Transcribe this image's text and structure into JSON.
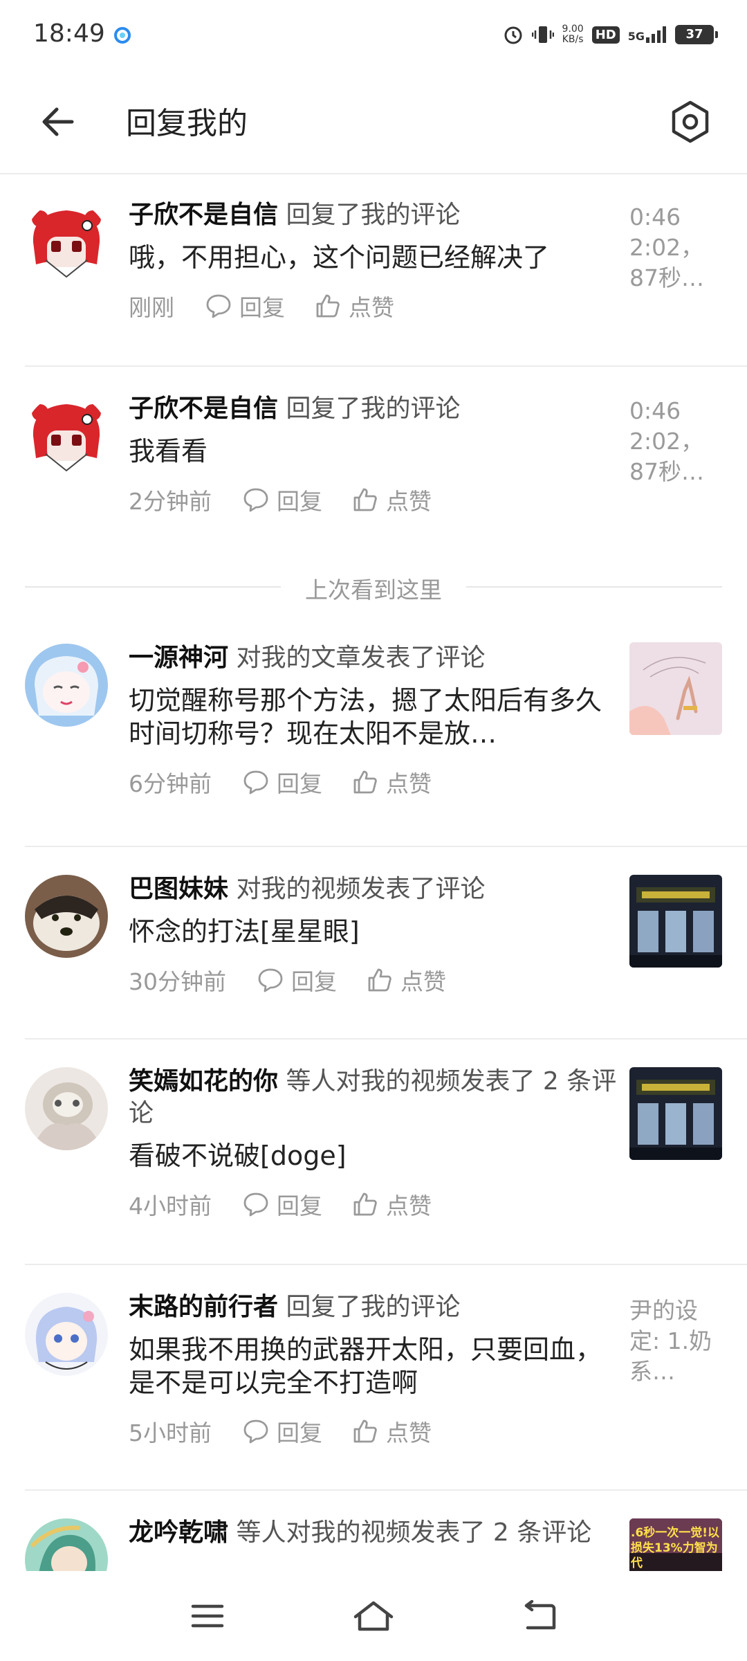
{
  "status_bar": {
    "time": "18:49",
    "net_speed_value": "9.00",
    "net_speed_unit": "KB/s",
    "hd": "HD",
    "network": "5G",
    "battery": "37"
  },
  "header": {
    "title": "回复我的",
    "back_icon": "arrow-left-icon",
    "settings_icon": "hexagon-settings-icon"
  },
  "divider_text": "上次看到这里",
  "actions": {
    "reply": "回复",
    "like": "点赞"
  },
  "items": [
    {
      "user": "子欣不是自信",
      "action": "回复了我的评论",
      "message": "哦，不用担心，这个问题已经解决了",
      "time": "刚刚",
      "side_text": "0:46 2:02，87秒…"
    },
    {
      "user": "子欣不是自信",
      "action": "回复了我的评论",
      "message": "我看看",
      "time": "2分钟前",
      "side_text": "0:46 2:02，87秒…"
    },
    {
      "user": "一源神河",
      "action": "对我的文章发表了评论",
      "message": "切觉醒称号那个方法，摁了太阳后有多久时间切称号？现在太阳不是放…",
      "time": "6分钟前"
    },
    {
      "user": "巴图妹妹",
      "action": "对我的视频发表了评论",
      "message": "怀念的打法[星星眼]",
      "time": "30分钟前"
    },
    {
      "user": "笑嫣如花的你",
      "action": "等人对我的视频发表了 2 条评论",
      "message": "看破不说破[doge]",
      "time": "4小时前"
    },
    {
      "user": "末路的前行者",
      "action": "回复了我的评论",
      "message": "如果我不用换的武器开太阳，只要回血，是不是可以完全不打造啊",
      "time": "5小时前",
      "side_text": "尹的设定: 1.奶系…"
    },
    {
      "user": "龙吟乾啸",
      "action": "等人对我的视频发表了 2 条评论",
      "thumb_text": ".6秒一次一觉!以损失13%力智为代"
    }
  ],
  "colors": {
    "text_primary": "#222222",
    "text_secondary": "#999999",
    "divider": "#ececec",
    "avatar_red": "#d8262b"
  }
}
